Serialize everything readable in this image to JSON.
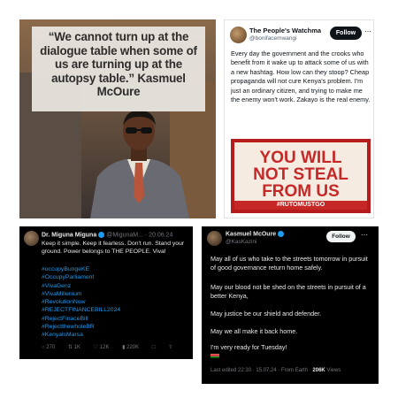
{
  "quote_card": {
    "text": "“We cannot turn up at the dialogue table when some of us are turning up at the autopsy table.” Kasmuel McOure"
  },
  "tweet_b": {
    "display_name": "The People's Watchma",
    "handle": "@bonifacemwangi",
    "follow_label": "Follow",
    "more_icon": "⋯",
    "body": "Every day the government and the crooks who benefit from it wake up to attack some of us with a new hashtag. How low can they stoop? Cheap propaganda will not cure Kenya's problem. I'm just an ordinary citizen, and trying to make me the enemy won't work. Zakayo is the real enemy.",
    "poster": {
      "line1": "YOU WILL",
      "line2": "NOT STEAL",
      "line3": "FROM US",
      "hashtag": "#RUTOMUSTGO"
    }
  },
  "tweet_c": {
    "display_name": "Dr. Miguna Miguna",
    "handle_date": "@MigunaM... · 20.06.24",
    "more_icon": "⋯",
    "body": "Keep it simple. Keep it fearless. Don't run. Stand your ground. Power belongs to THE PEOPLE. Viva!",
    "hashtags": [
      "#occupyBungeKE",
      "#OccupyParliament",
      "#VivaGenz",
      "#VivaMillenium",
      "#RevolutionNow",
      "#REJECTFINANCEBILL2024",
      "#RejectFinaceBill",
      "#RejectthewholeBR",
      "#KenyalsMarsa"
    ],
    "actions": {
      "replies": "270",
      "reposts": "1K",
      "likes": "12K",
      "views": "220K"
    }
  },
  "tweet_d": {
    "display_name": "Kasmuel McOure",
    "handle": "@KasKazini",
    "follow_label": "Follow",
    "more_icon": "⋯",
    "paragraphs": [
      "May all of us who take to the streets tomorrow in pursuit of good governance return home safely.",
      "May our blood not be shed on the streets in pursuit of a better Kenya,",
      "May justice be our shield and defender.",
      "May we all make it back home.",
      "I'm very ready for Tuesday!"
    ],
    "meta_prefix": "Last edited 22:30 · 15.07.24 · From Earth ·",
    "views_count": "206K",
    "views_label": "Views"
  }
}
